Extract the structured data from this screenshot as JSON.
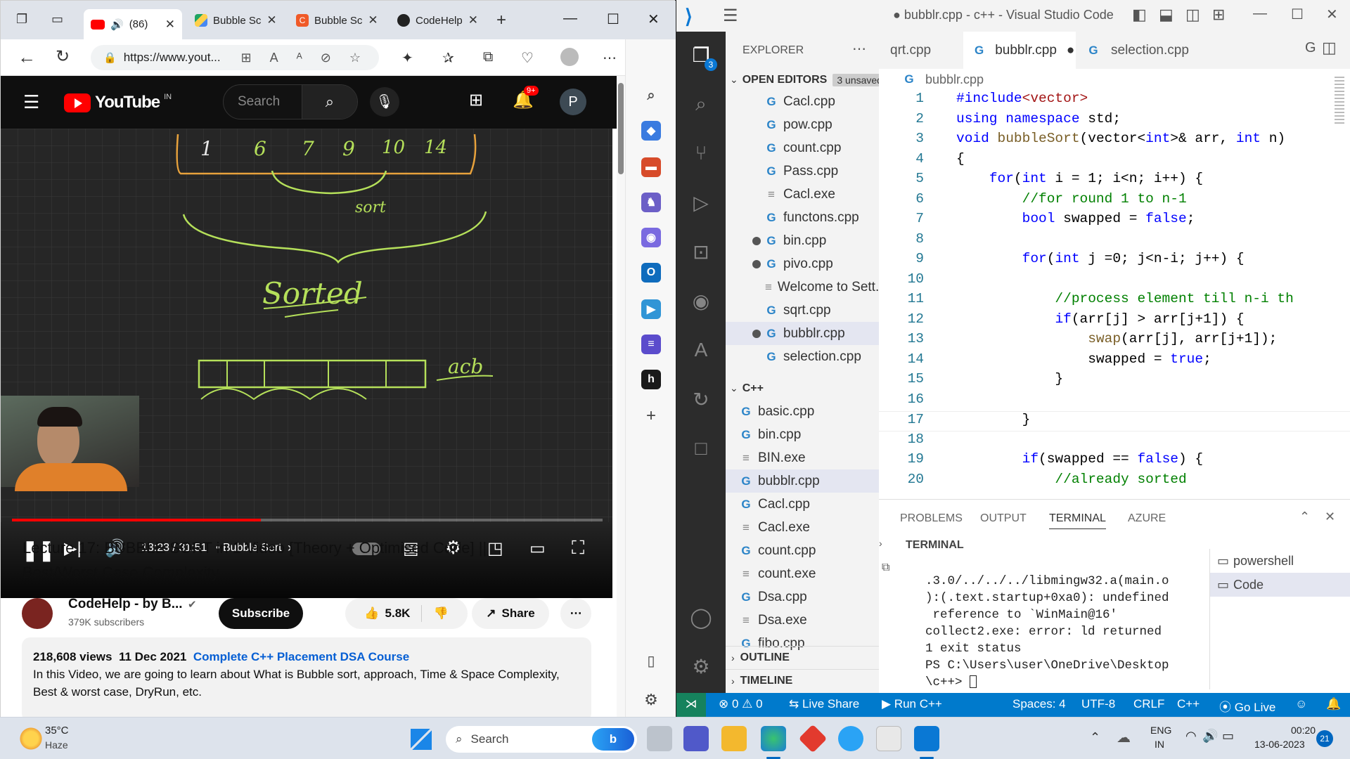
{
  "edge": {
    "tabs": [
      {
        "label": "(86)",
        "icon": "youtube-icon",
        "active": true
      },
      {
        "label": "Bubble Sc",
        "icon": "google-drive-icon"
      },
      {
        "label": "Bubble Sc",
        "icon": "codehelp-icon"
      },
      {
        "label": "CodeHelp",
        "icon": "github-icon"
      }
    ],
    "url": "https://www.yout...",
    "window_controls": {
      "minimize": "—",
      "maximize": "☐",
      "close": "✕"
    }
  },
  "youtube": {
    "logo_text": "YouTube",
    "logo_region": "IN",
    "search_placeholder": "Search",
    "notification_count": "9+",
    "avatar_letter": "P",
    "player": {
      "time": "13:23 / 31:51",
      "chapter": "Bubble Sort",
      "progress_fraction": 0.421,
      "board_numbers": [
        "1",
        "6",
        "7",
        "9",
        "10",
        "14"
      ],
      "board_words": [
        "sort",
        "Sorted",
        "acb"
      ]
    },
    "video_title": "Lecture 17: BUBBLE SORT in 1 Video [Theory + Optimised Code] || Best/Worst Case Complexity",
    "channel": {
      "name": "CodeHelp - by B...",
      "subscribers": "379K subscribers"
    },
    "subscribe_label": "Subscribe",
    "likes": "5.8K",
    "share_label": "Share",
    "description": {
      "views": "218,608 views",
      "date": "11 Dec 2021",
      "playlist_link": "Complete C++ Placement DSA Course",
      "text": "In this Video, we are going to learn about What is Bubble sort, approach, Time & Space Complexity, Best & worst case, DryRun, etc."
    }
  },
  "vscode": {
    "title": "● bubblr.cpp - c++ - Visual Studio Code",
    "explorer_title": "EXPLORER",
    "open_editors_label": "OPEN EDITORS",
    "unsaved_badge": "3 unsaved",
    "activity_badge": "3",
    "open_editors": [
      {
        "name": "Cacl.cpp",
        "type": "cpp",
        "dirty": false
      },
      {
        "name": "pow.cpp",
        "type": "cpp",
        "dirty": false
      },
      {
        "name": "count.cpp",
        "type": "cpp",
        "dirty": false
      },
      {
        "name": "Pass.cpp",
        "type": "cpp",
        "dirty": false
      },
      {
        "name": "Cacl.exe",
        "type": "exe",
        "dirty": false
      },
      {
        "name": "functons.cpp",
        "type": "cpp",
        "dirty": false
      },
      {
        "name": "bin.cpp",
        "type": "cpp",
        "dirty": true
      },
      {
        "name": "pivo.cpp",
        "type": "cpp",
        "dirty": true
      },
      {
        "name": "Welcome to Sett...",
        "type": "exe",
        "dirty": false
      },
      {
        "name": "sqrt.cpp",
        "type": "cpp",
        "dirty": false
      },
      {
        "name": "bubblr.cpp",
        "type": "cpp",
        "dirty": true
      },
      {
        "name": "selection.cpp",
        "type": "cpp",
        "dirty": false
      }
    ],
    "folder_label": "C++",
    "folder_files": [
      {
        "name": "basic.cpp",
        "type": "cpp"
      },
      {
        "name": "bin.cpp",
        "type": "cpp"
      },
      {
        "name": "BIN.exe",
        "type": "exe"
      },
      {
        "name": "bubblr.cpp",
        "type": "cpp"
      },
      {
        "name": "Cacl.cpp",
        "type": "cpp"
      },
      {
        "name": "Cacl.exe",
        "type": "exe"
      },
      {
        "name": "count.cpp",
        "type": "cpp"
      },
      {
        "name": "count.exe",
        "type": "exe"
      },
      {
        "name": "Dsa.cpp",
        "type": "cpp"
      },
      {
        "name": "Dsa.exe",
        "type": "exe"
      },
      {
        "name": "fibo.cpp",
        "type": "cpp"
      }
    ],
    "outline_label": "OUTLINE",
    "timeline_label": "TIMELINE",
    "editor_tabs": [
      "qrt.cpp",
      "bubblr.cpp",
      "selection.cpp"
    ],
    "breadcrumb": "bubblr.cpp",
    "code_lines": [
      "#include<vector>",
      "using namespace std;",
      "void bubbleSort(vector<int>& arr, int n)",
      "{",
      "    for(int i = 1; i<n; i++) {",
      "        //for round 1 to n-1",
      "        bool swapped = false;",
      "",
      "        for(int j =0; j<n-i; j++) {",
      "",
      "            //process element till n-i th",
      "            if(arr[j] > arr[j+1]) {",
      "                swap(arr[j], arr[j+1]);",
      "                swapped = true;",
      "            }",
      "",
      "        }",
      "",
      "        if(swapped == false) {",
      "            //already sorted"
    ],
    "panel_tabs": [
      "PROBLEMS",
      "OUTPUT",
      "TERMINAL",
      "AZURE"
    ],
    "terminal_header": "TERMINAL",
    "terminal_lines": [
      ".3.0/../../../libmingw32.a(main.o",
      "):(.text.startup+0xa0): undefined",
      " reference to `WinMain@16'",
      "collect2.exe: error: ld returned",
      "1 exit status",
      "PS C:\\Users\\user\\OneDrive\\Desktop",
      "\\c++> "
    ],
    "terminal_sessions": [
      "powershell",
      "Code"
    ],
    "status": {
      "errors": "0",
      "warnings": "0",
      "live_share": "Live Share",
      "run": "Run C++",
      "spaces": "Spaces: 4",
      "encoding": "UTF-8",
      "eol": "CRLF",
      "language": "C++",
      "go_live": "Go Live"
    }
  },
  "taskbar": {
    "weather_temp": "35°C",
    "weather_desc": "Haze",
    "search_placeholder": "Search",
    "lang": "ENG",
    "region": "IN",
    "time": "00:20",
    "date": "13-06-2023",
    "notification_count": "21"
  },
  "colors": {
    "vscode_blue": "#007acc",
    "youtube_red": "#ff0000",
    "board_chalk": "#b5e05a"
  }
}
